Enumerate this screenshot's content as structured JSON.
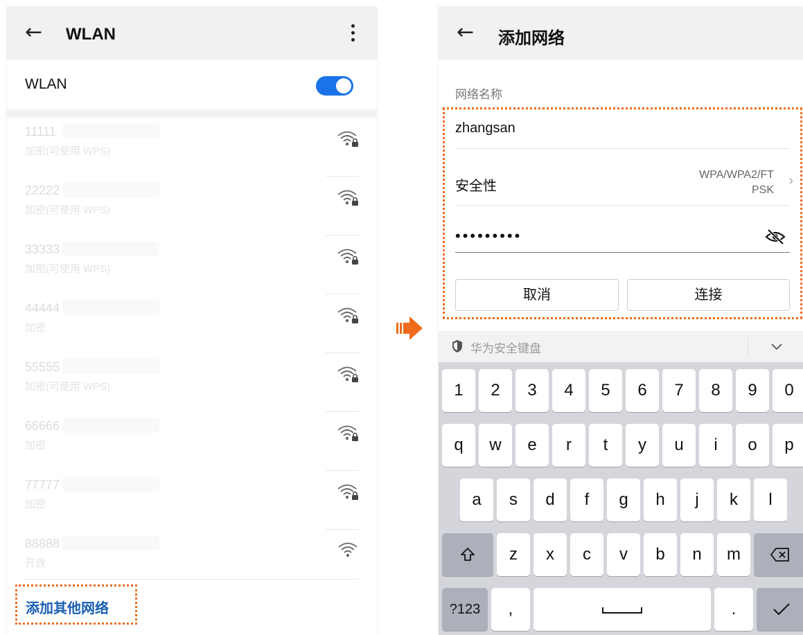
{
  "left_screen": {
    "header": {
      "back_icon": "arrow-left-icon",
      "title": "WLAN",
      "more_icon": "more-vertical-icon"
    },
    "wlan_toggle": {
      "label": "WLAN",
      "state": "on",
      "accent_color": "#1a73e8"
    },
    "networks": [
      {
        "ssid": "11111",
        "status": "加密(可使用 WPS)",
        "icon": "wifi-lock-icon"
      },
      {
        "ssid": "22222",
        "status": "加密(可使用 WPS)",
        "icon": "wifi-lock-icon"
      },
      {
        "ssid": "33333",
        "status": "加密(可使用 WPS)",
        "icon": "wifi-lock-icon"
      },
      {
        "ssid": "44444",
        "status": "加密",
        "icon": "wifi-lock-icon"
      },
      {
        "ssid": "55555",
        "status": "加密(可使用 WPS)",
        "icon": "wifi-lock-icon"
      },
      {
        "ssid": "66666",
        "status": "加密",
        "icon": "wifi-lock-icon"
      },
      {
        "ssid": "77777",
        "status": "加密",
        "icon": "wifi-lock-icon"
      },
      {
        "ssid": "88888",
        "status": "开放",
        "icon": "wifi-open-icon"
      }
    ],
    "add_other_network": "添加其他网络",
    "highlight_color": "#ee6b1c"
  },
  "transition_arrow_icon": "arrow-right-icon",
  "right_screen": {
    "header": {
      "back_icon": "arrow-left-icon",
      "title": "添加网络"
    },
    "network_name_label": "网络名称",
    "ssid_value": "zhangsan",
    "security": {
      "label": "安全性",
      "value_line1": "WPA/WPA2/FT",
      "value_line2": "PSK"
    },
    "password_masked": "•••••••••",
    "password_icon": "eye-off-icon",
    "cancel_button": "取消",
    "connect_button": "连接",
    "keyboard": {
      "title": "华为安全键盘",
      "row1": [
        "1",
        "2",
        "3",
        "4",
        "5",
        "6",
        "7",
        "8",
        "9",
        "0"
      ],
      "row2": [
        "q",
        "w",
        "e",
        "r",
        "t",
        "y",
        "u",
        "i",
        "o",
        "p"
      ],
      "row3": [
        "a",
        "s",
        "d",
        "f",
        "g",
        "h",
        "j",
        "k",
        "l"
      ],
      "row4": [
        "z",
        "x",
        "c",
        "v",
        "b",
        "n",
        "m"
      ],
      "shift_icon": "shift-icon",
      "backspace_icon": "backspace-icon",
      "symbols_key": "?123",
      "comma_key": ",",
      "period_key": ".",
      "enter_icon": "checkmark-icon"
    }
  }
}
